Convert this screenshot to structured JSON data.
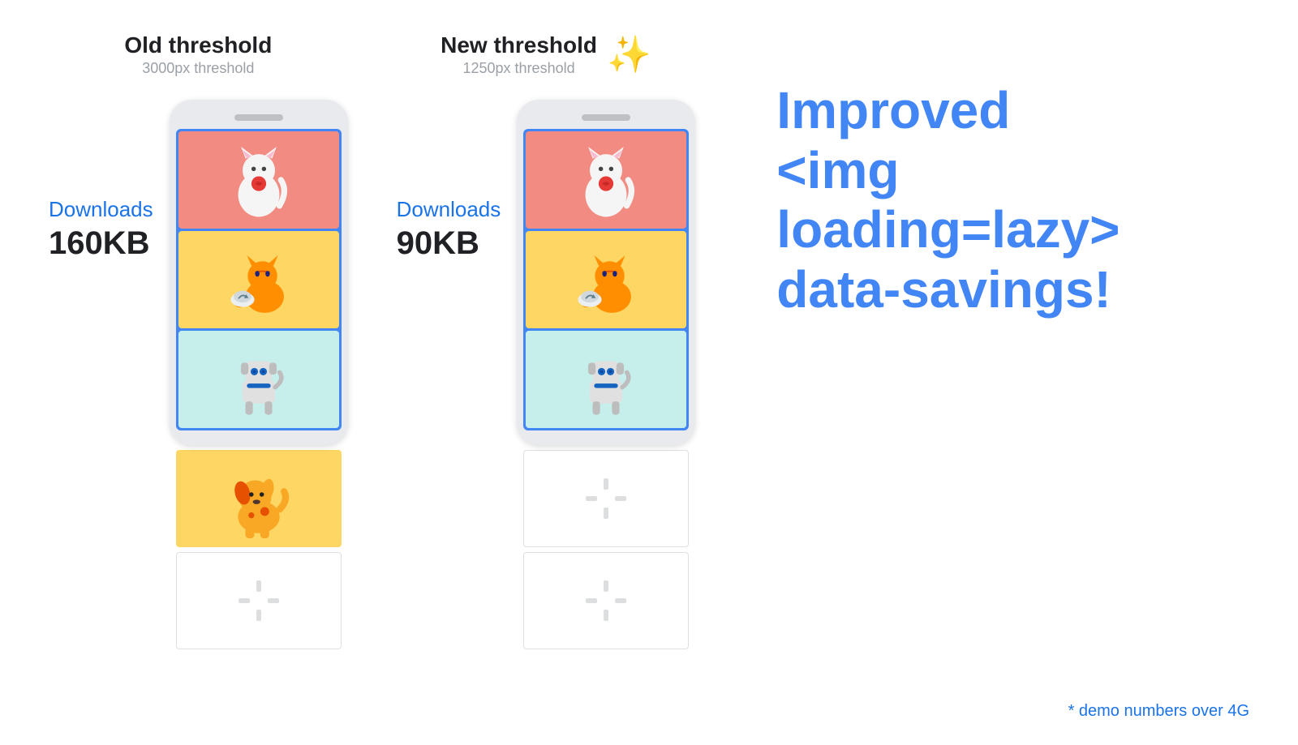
{
  "old_threshold": {
    "title": "Old threshold",
    "subtitle": "3000px threshold",
    "downloads_label": "Downloads",
    "downloads_size": "160KB"
  },
  "new_threshold": {
    "title": "New threshold",
    "subtitle": "1250px threshold",
    "downloads_label": "Downloads",
    "downloads_size": "90KB"
  },
  "improved_text_line1": "Improved",
  "improved_text_line2": "<img loading=lazy>",
  "improved_text_line3": "data-savings!",
  "demo_note": "* demo numbers over 4G"
}
